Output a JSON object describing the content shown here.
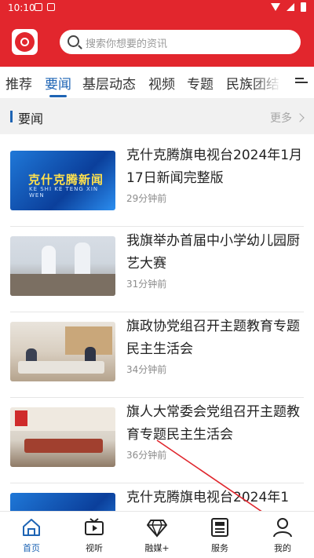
{
  "status_bar": {
    "time": "10:10"
  },
  "search": {
    "placeholder": "搜索你想要的资讯"
  },
  "tabs": [
    {
      "label": "推荐"
    },
    {
      "label": "要闻"
    },
    {
      "label": "基层动态"
    },
    {
      "label": "视频"
    },
    {
      "label": "专题"
    },
    {
      "label": "民族团结"
    }
  ],
  "active_tab": "要闻",
  "section": {
    "title": "要闻",
    "more": "更多"
  },
  "news": [
    {
      "title": "克什克腾旗电视台2024年1月17日新闻完整版",
      "time": "29分钟前",
      "thumb_text": "克什克腾新闻",
      "thumb_subtext": "KE SHI KE TENG XIN WEN"
    },
    {
      "title": "我旗举办首届中小学幼儿园厨艺大赛",
      "time": "31分钟前"
    },
    {
      "title": "旗政协党组召开主题教育专题民主生活会",
      "time": "34分钟前"
    },
    {
      "title": "旗人大常委会党组召开主题教育专题民主生活会",
      "time": "36分钟前"
    },
    {
      "title": "克什克腾旗电视台2024年1"
    }
  ],
  "bottom_nav": [
    {
      "label": "首页",
      "icon": "home-icon",
      "active": true
    },
    {
      "label": "视听",
      "icon": "tv-icon"
    },
    {
      "label": "融媒+",
      "icon": "diamond-icon"
    },
    {
      "label": "服务",
      "icon": "newspaper-icon"
    },
    {
      "label": "我的",
      "icon": "user-icon"
    }
  ],
  "colors": {
    "brand_red": "#e2262d",
    "accent_blue": "#1e64b4",
    "annotation_red": "#e0262d"
  }
}
